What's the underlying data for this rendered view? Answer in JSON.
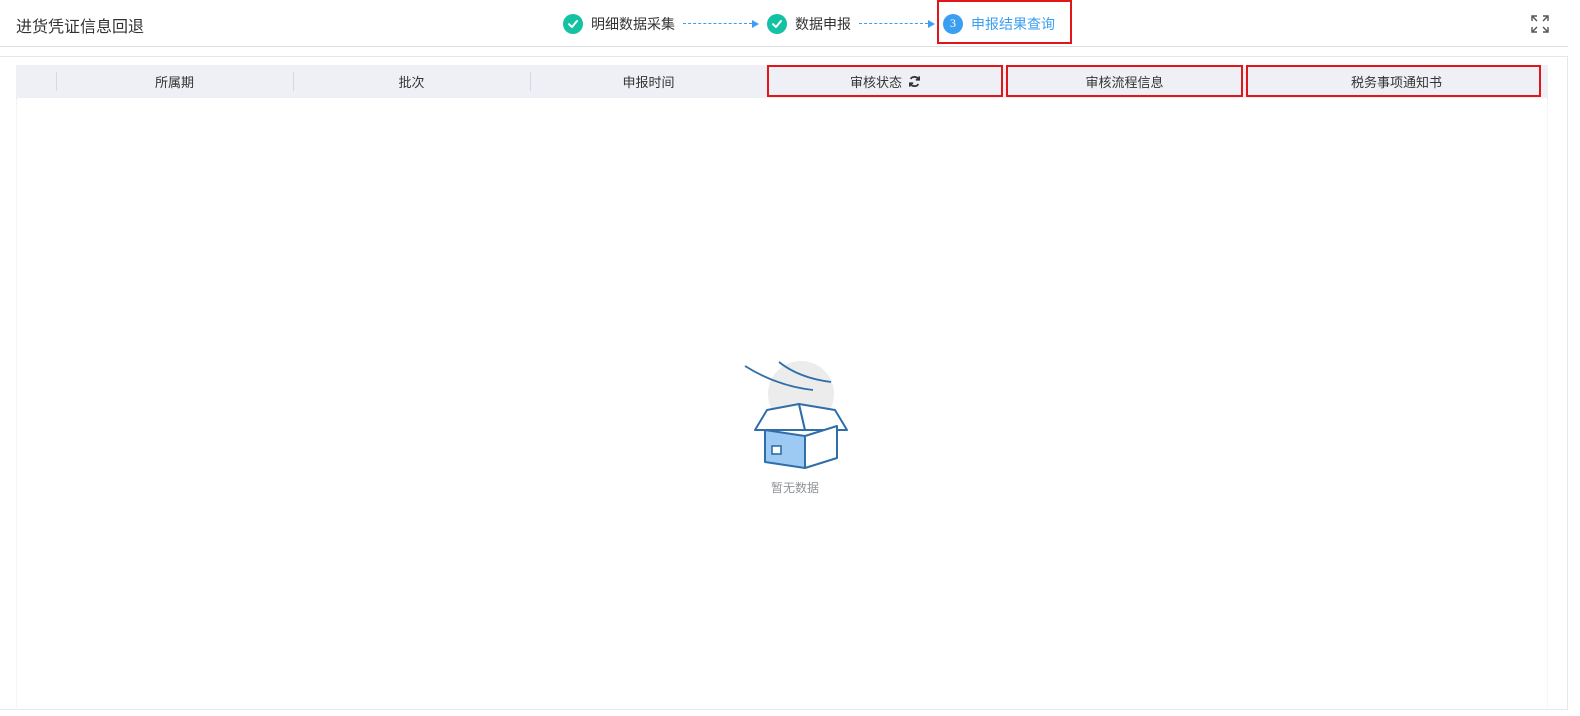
{
  "header": {
    "title": "进货凭证信息回退",
    "steps": [
      {
        "label": "明细数据采集",
        "state": "done"
      },
      {
        "label": "数据申报",
        "state": "done"
      },
      {
        "label": "申报结果查询",
        "state": "active",
        "number": "3"
      }
    ],
    "fullscreen_icon": "fullscreen-icon"
  },
  "table": {
    "columns": [
      "所属期",
      "批次",
      "申报时间",
      "审核状态",
      "审核流程信息",
      "税务事项通知书"
    ],
    "refresh_icon": "refresh-icon",
    "empty_text": "暂无数据"
  },
  "colors": {
    "accent": "#3a9ff0",
    "done": "#13c2a3",
    "highlight": "#e0161a",
    "header_bg": "#eef0f5"
  }
}
